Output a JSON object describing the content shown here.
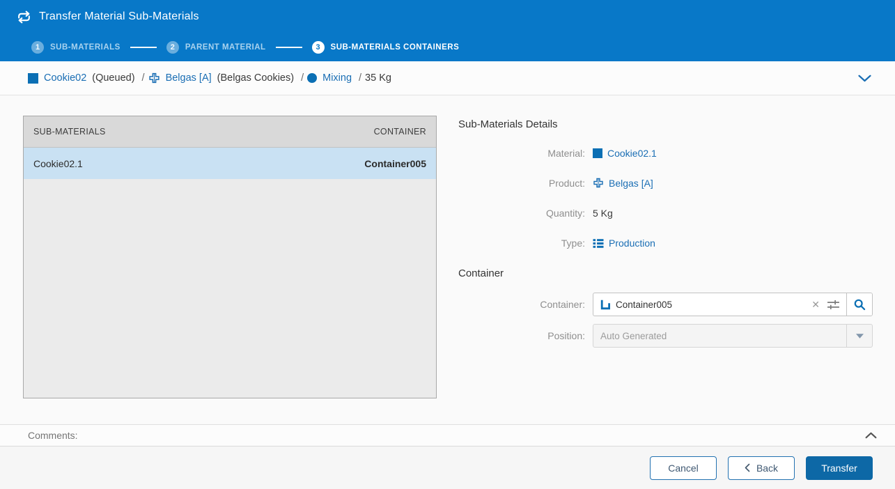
{
  "header": {
    "title": "Transfer Material Sub-Materials",
    "steps": [
      {
        "num": "1",
        "label": "SUB-MATERIALS",
        "active": false
      },
      {
        "num": "2",
        "label": "PARENT MATERIAL",
        "active": false
      },
      {
        "num": "3",
        "label": "SUB-MATERIALS CONTAINERS",
        "active": true
      }
    ]
  },
  "breadcrumb": {
    "material": "Cookie02",
    "material_status": "(Queued)",
    "separator": "/",
    "product": "Belgas [A]",
    "product_desc": "(Belgas Cookies)",
    "step": "Mixing",
    "quantity": "35 Kg"
  },
  "table": {
    "headers": {
      "col1": "SUB-MATERIALS",
      "col2": "CONTAINER"
    },
    "rows": [
      {
        "sub_material": "Cookie02.1",
        "container": "Container005"
      }
    ]
  },
  "details": {
    "title": "Sub-Materials Details",
    "material_label": "Material:",
    "material_value": "Cookie02.1",
    "product_label": "Product:",
    "product_value": "Belgas [A]",
    "quantity_label": "Quantity:",
    "quantity_value": "5 Kg",
    "type_label": "Type:",
    "type_value": "Production"
  },
  "container_section": {
    "title": "Container",
    "container_label": "Container:",
    "container_value": "Container005",
    "position_label": "Position:",
    "position_placeholder": "Auto Generated"
  },
  "comments": {
    "label": "Comments:"
  },
  "footer": {
    "cancel_label": "Cancel",
    "back_label": "Back",
    "transfer_label": "Transfer"
  },
  "icons": {
    "app": "transfer-arrows-icon",
    "material": "material-square-icon",
    "product": "product-cross-icon",
    "operation": "operation-circle-icon",
    "type": "production-list-icon",
    "container": "container-icon",
    "clear": "clear-x-icon",
    "filter": "sliders-icon",
    "search": "magnifier-icon"
  },
  "colors": {
    "header_blue": "#0878c8",
    "link_blue": "#1a6eb4",
    "icon_blue": "#0b6fb4",
    "primary_button_blue": "#0d68a6",
    "selected_row_blue": "#c9e1f3",
    "grid_header_gray": "#d9d9d9"
  }
}
